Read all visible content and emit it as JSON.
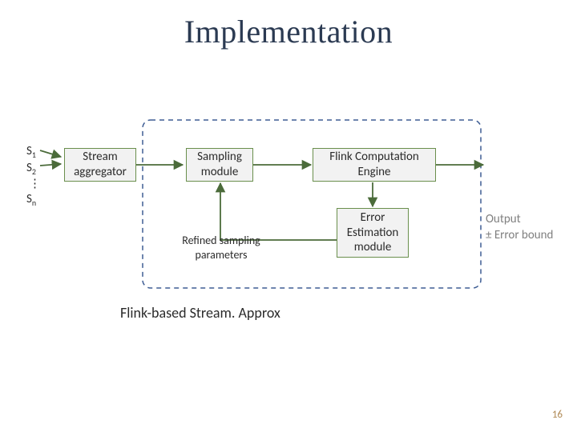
{
  "title": "Implementation",
  "streams": {
    "s1": "S",
    "s2": "S",
    "dots": "⋮",
    "sn": "S",
    "sub1": "1",
    "sub2": "2",
    "subn": "n"
  },
  "boxes": {
    "aggregator": "Stream\naggregator",
    "sampling": "Sampling\nmodule",
    "flink": "Flink Computation\nEngine",
    "error": "Error\nEstimation\nmodule"
  },
  "feedback_label": "Refined sampling\nparameters",
  "output_label": "Output\n± Error bound",
  "caption": "Flink-based Stream. Approx",
  "page_number": "16",
  "colors": {
    "box_border": "#6a8f4d",
    "arrow": "#4b6b3a",
    "dashed": "#3e5d94"
  }
}
